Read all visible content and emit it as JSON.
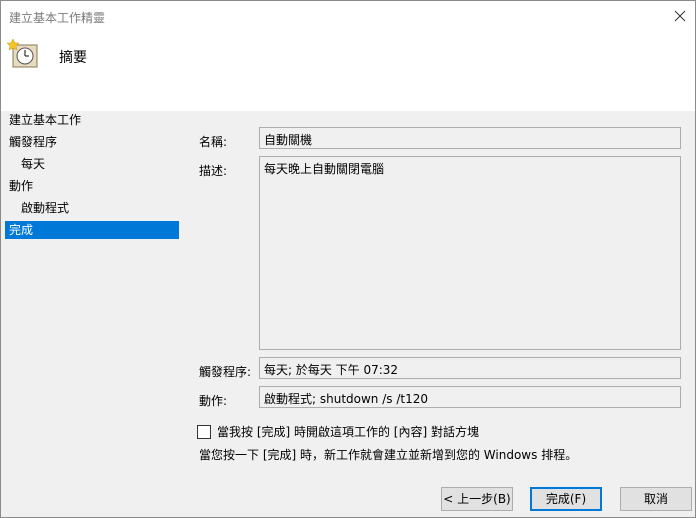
{
  "window": {
    "title": "建立基本工作精靈"
  },
  "header": {
    "title": "摘要",
    "icon": "clock-task-icon"
  },
  "nav": {
    "items": [
      {
        "label": "建立基本工作",
        "indent": false,
        "selected": false
      },
      {
        "label": "觸發程序",
        "indent": false,
        "selected": false
      },
      {
        "label": "每天",
        "indent": true,
        "selected": false
      },
      {
        "label": "動作",
        "indent": false,
        "selected": false
      },
      {
        "label": "啟動程式",
        "indent": true,
        "selected": false
      },
      {
        "label": "完成",
        "indent": false,
        "selected": true
      }
    ]
  },
  "form": {
    "name_label": "名稱:",
    "name_value": "自動關機",
    "description_label": "描述:",
    "description_value": "每天晚上自動關閉電腦",
    "trigger_label": "觸發程序:",
    "trigger_value": "每天; 於每天 下午 07:32",
    "action_label": "動作:",
    "action_value": "啟動程式; shutdown /s /t120",
    "open_properties_label": "當我按 [完成] 時開啟這項工作的 [內容] 對話方塊",
    "note": "當您按一下 [完成] 時，新工作就會建立並新增到您的 Windows 排程。"
  },
  "buttons": {
    "back": "< 上一步(B)",
    "finish": "完成(F)",
    "cancel": "取消"
  }
}
